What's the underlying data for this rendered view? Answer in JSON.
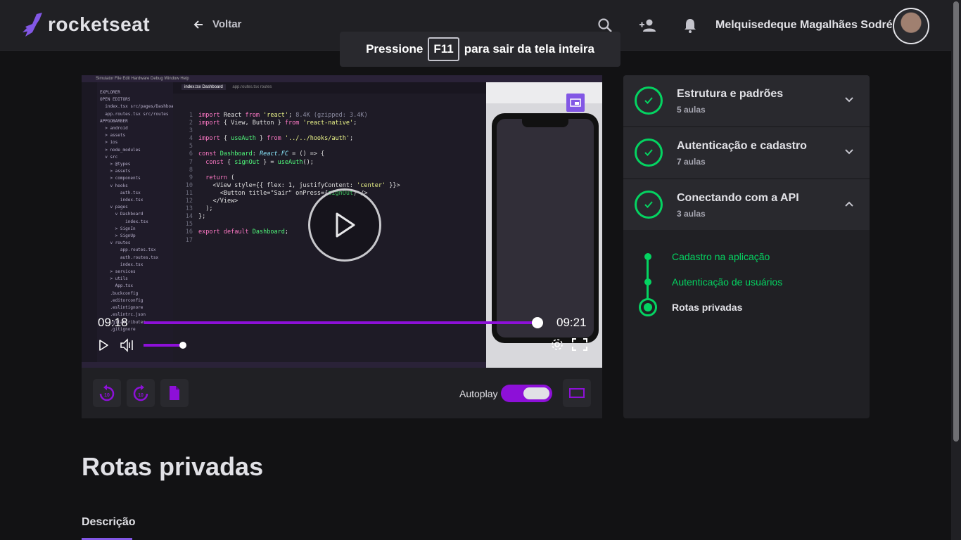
{
  "header": {
    "logo": "rocketseat",
    "back_label": "Voltar",
    "username": "Melquisedeque Magalhães Sodré",
    "icons": [
      "search-icon",
      "add-user-icon",
      "bell-icon"
    ]
  },
  "toast": {
    "prefix": "Pressione",
    "key": "F11",
    "suffix": "para sair da tela inteira"
  },
  "player": {
    "current_time": "09:18",
    "duration": "09:21",
    "progress_fraction": 0.98,
    "volume_fraction": 1.0,
    "accent": "#8d10d8"
  },
  "video_frame": {
    "menubar": "Simulator   File   Edit   Hardware   Debug   Window   Help",
    "tab_active": "index.tsx Dashboard",
    "tab_inactive": "app.routes.tsx routes",
    "code": [
      "import React from 'react'; 8.4K (gzipped: 3.4K)",
      "import { View, Button } from 'react-native';",
      "",
      "import { useAuth } from '../../hooks/auth';",
      "",
      "const Dashboard: React.FC = () => {",
      "  const { signOut } = useAuth();",
      "",
      "  return (",
      "    <View style={{ flex: 1, justifyContent: 'center' }}>",
      "      <Button title=\"Sair\" onPress={signOut} />",
      "    </View>",
      "  );",
      "};",
      "",
      "export default Dashboard;",
      ""
    ],
    "explorer": "EXPLORER\nOPEN EDITORS\n  index.tsx src/pages/Dashboard\n  app.routes.tsx src/routes\nAPPGOBARBER\n  > android\n  > assets\n  > ios\n  > node_modules\n  v src\n    > @types\n    > assets\n    > components\n    v hooks\n        auth.tsx\n        index.tsx\n    v pages\n      v Dashboard\n          index.tsx\n      > SignIn\n      > SignUp\n    v routes\n        app.routes.tsx\n        auth.routes.tsx\n        index.tsx\n    > services\n    > utils\n      App.tsx\n    .buckconfig\n    .editorconfig\n    .eslintignore\n    .eslintrc.json\n    .gitattributes\n    .gitignore"
  },
  "toolbar": {
    "autoplay_label": "Autoplay",
    "autoplay_on": true,
    "buttons": [
      "rewind-10-icon",
      "forward-10-icon",
      "file-icon",
      "theater-mode-icon"
    ]
  },
  "modules": [
    {
      "title": "Estrutura e padrões",
      "subtitle": "5 aulas",
      "expanded": false
    },
    {
      "title": "Autenticação e cadastro",
      "subtitle": "7 aulas",
      "expanded": false
    },
    {
      "title": "Conectando com a API",
      "subtitle": "3 aulas",
      "expanded": true
    }
  ],
  "lessons": [
    {
      "title": "Cadastro na aplicação",
      "active": false
    },
    {
      "title": "Autenticação de usuários",
      "active": false
    },
    {
      "title": "Rotas privadas",
      "active": true
    }
  ],
  "page": {
    "title": "Rotas privadas",
    "tab_description": "Descrição"
  },
  "colors": {
    "brand": "#8257e5",
    "success": "#04d361",
    "background": "#121214",
    "surface": "#202024"
  }
}
